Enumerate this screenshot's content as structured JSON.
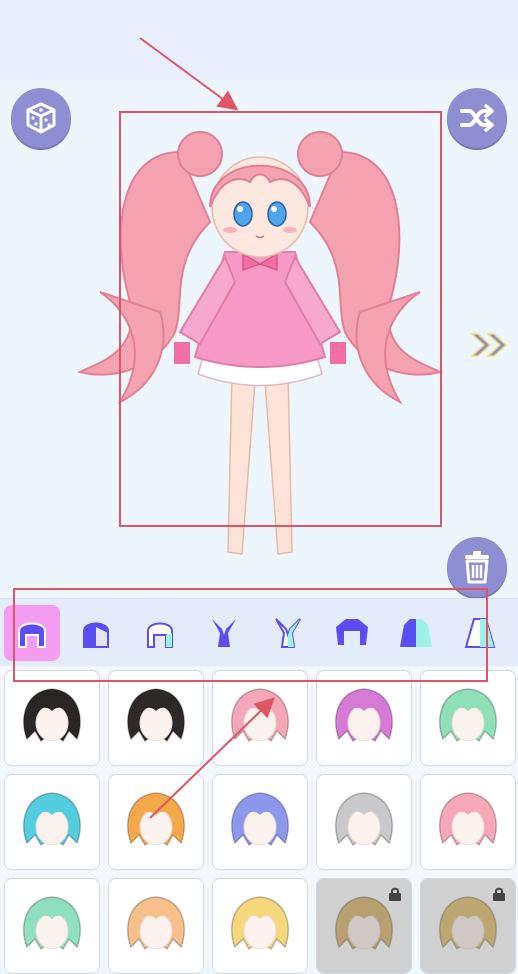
{
  "colors": {
    "accent_button": "#8e8fd2",
    "tab_active": "#f39cf1",
    "tab_icon": "#5b4ff3",
    "annotation": "#e05563"
  },
  "toolbar": {
    "random_icon": "dice-icon",
    "shuffle_icon": "shuffle-icon",
    "delete_icon": "trash-icon",
    "next_icon": "double-chevron-right-icon"
  },
  "categories": [
    {
      "name": "hair-front",
      "active": true
    },
    {
      "name": "hair-back",
      "active": false
    },
    {
      "name": "hair-side",
      "active": false
    },
    {
      "name": "ears",
      "active": false
    },
    {
      "name": "ears-alt",
      "active": false
    },
    {
      "name": "top",
      "active": false
    },
    {
      "name": "outfit",
      "active": false
    },
    {
      "name": "dress",
      "active": false
    }
  ],
  "items": [
    {
      "name": "black-bob-hair",
      "color": "#2b2626",
      "locked": false
    },
    {
      "name": "black-messy-hair",
      "color": "#2e2929",
      "locked": false
    },
    {
      "name": "pink-twin-tails",
      "color": "#f4a7b9",
      "locked": false
    },
    {
      "name": "magenta-long-hair",
      "color": "#d67ad6",
      "locked": false
    },
    {
      "name": "mint-long-hair",
      "color": "#8fe0b8",
      "locked": false
    },
    {
      "name": "cyan-spiky-hair",
      "color": "#54cde0",
      "locked": false
    },
    {
      "name": "orange-messy-hair",
      "color": "#f5a84a",
      "locked": false
    },
    {
      "name": "blue-short-hair",
      "color": "#8d97ec",
      "locked": false
    },
    {
      "name": "silver-short-hair",
      "color": "#c9c9cc",
      "locked": false
    },
    {
      "name": "pink-bob-hair",
      "color": "#f7a8b8",
      "locked": false
    },
    {
      "name": "mint-twin-buns",
      "color": "#8fe0c0",
      "locked": false
    },
    {
      "name": "peach-short-hair",
      "color": "#f7c08a",
      "locked": false
    },
    {
      "name": "blonde-long-hair",
      "color": "#f6d77c",
      "locked": false
    },
    {
      "name": "locked-hair-1",
      "color": "#d9b46a",
      "locked": true
    },
    {
      "name": "locked-hair-2",
      "color": "#e0c070",
      "locked": true
    }
  ]
}
